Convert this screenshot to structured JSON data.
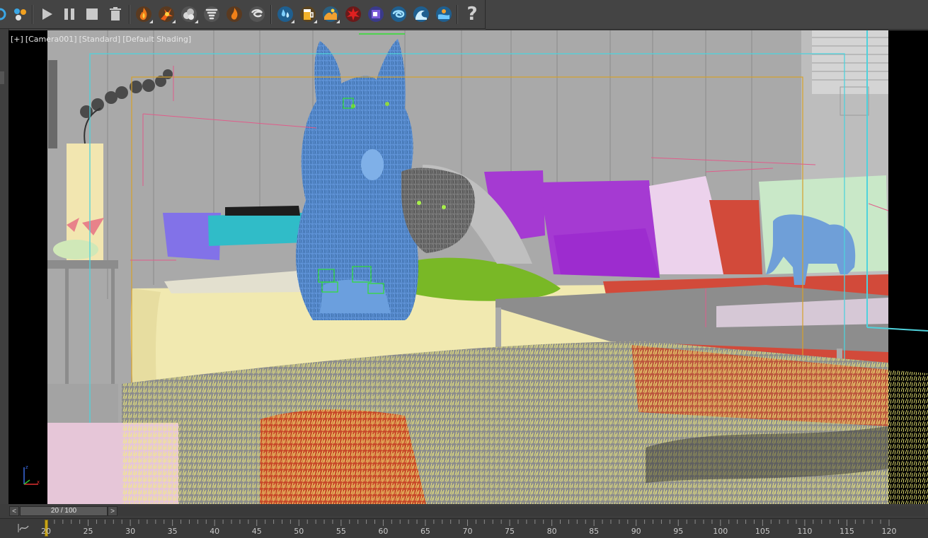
{
  "toolbar": {
    "buttons": [
      {
        "icon": "partial-circle-icon"
      },
      {
        "icon": "particle-view-icon"
      },
      {
        "icon": "play-icon"
      },
      {
        "icon": "pause-icon"
      },
      {
        "icon": "stop-icon"
      },
      {
        "icon": "trash-icon"
      },
      {
        "icon": "fire-icon"
      },
      {
        "icon": "explosion-icon"
      },
      {
        "icon": "smoke-icon"
      },
      {
        "icon": "tornado-icon"
      },
      {
        "icon": "flame-icon"
      },
      {
        "icon": "swirl-smoke-icon"
      },
      {
        "icon": "liquid-drops-icon"
      },
      {
        "icon": "beer-mug-icon"
      },
      {
        "icon": "wave-splash-icon"
      },
      {
        "icon": "red-splat-icon"
      },
      {
        "icon": "blue-box-icon"
      },
      {
        "icon": "water-vortex-icon"
      },
      {
        "icon": "ocean-wave-icon"
      },
      {
        "icon": "water-tank-icon"
      },
      {
        "icon": "help-icon"
      }
    ],
    "help_label": "?"
  },
  "viewport": {
    "label_parts": [
      "[+]",
      "[Camera001]",
      "[Standard]",
      "[Default Shading]"
    ],
    "frame_color": "#c8a418",
    "safe_frame_color": "#4fd2dc"
  },
  "timeline": {
    "prev_label": "<",
    "next_label": ">",
    "frame_display": "20 / 100",
    "current_frame": 20,
    "ruler_labels": [
      "20",
      "25",
      "30",
      "35",
      "40",
      "45",
      "50",
      "55",
      "60",
      "65",
      "70",
      "75",
      "80",
      "85",
      "90",
      "95",
      "100",
      "105",
      "110",
      "115",
      "120"
    ]
  },
  "colors": {
    "ui_bg": "#444444",
    "accent": "#c8a418",
    "fur_yellow": "#f4f07a"
  }
}
